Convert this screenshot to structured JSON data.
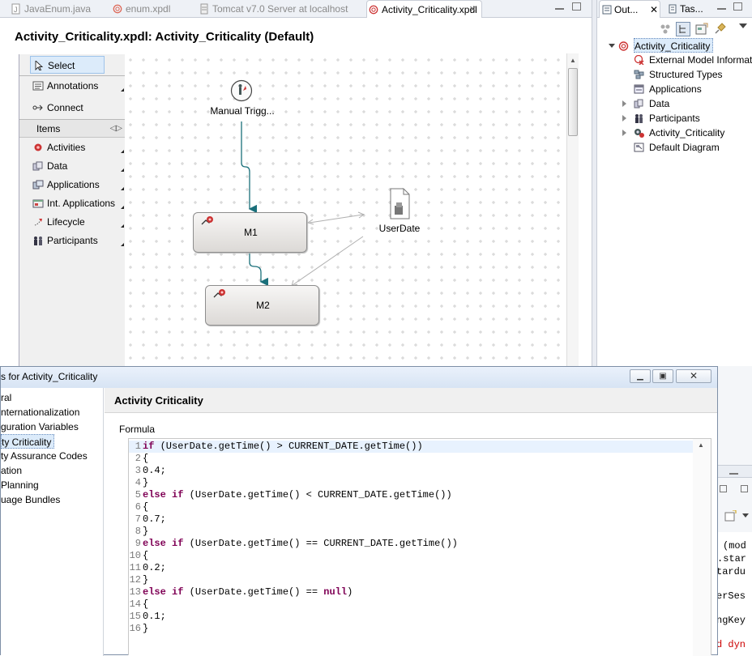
{
  "editor": {
    "tabs": [
      {
        "label": "JavaEnum.java"
      },
      {
        "label": "enum.xpdl"
      },
      {
        "label": "Tomcat v7.0 Server at localhost"
      },
      {
        "label": "Activity_Criticality.xpdl"
      }
    ],
    "title": "Activity_Criticality.xpdl: Activity_Criticality (Default)"
  },
  "palette": {
    "tools": [
      {
        "label": "Select",
        "icon": "cursor-icon"
      },
      {
        "label": "Annotations",
        "icon": "annotation-icon"
      },
      {
        "label": "Connect",
        "icon": "connect-icon"
      }
    ],
    "items_header": "Items",
    "items": [
      {
        "label": "Activities",
        "icon": "activity-icon"
      },
      {
        "label": "Data",
        "icon": "data-icon"
      },
      {
        "label": "Applications",
        "icon": "application-icon"
      },
      {
        "label": "Int. Applications",
        "icon": "interactive-application-icon"
      },
      {
        "label": "Lifecycle",
        "icon": "lifecycle-icon"
      },
      {
        "label": "Participants",
        "icon": "participants-icon"
      }
    ]
  },
  "diagram": {
    "trigger": {
      "label": "Manual Trigg..."
    },
    "data_node": {
      "label": "UserDate"
    },
    "activities": [
      {
        "label": "M1"
      },
      {
        "label": "M2"
      }
    ]
  },
  "outline": {
    "tabs": [
      {
        "label": "Out..."
      },
      {
        "label": "Tas..."
      }
    ],
    "root": "Activity_Criticality",
    "items": [
      {
        "label": "External Model Informat",
        "icon": "external-model-icon"
      },
      {
        "label": "Structured Types",
        "icon": "structured-types-icon"
      },
      {
        "label": "Applications",
        "icon": "applications-icon"
      },
      {
        "label": "Data",
        "icon": "data-icon",
        "expandable": true
      },
      {
        "label": "Participants",
        "icon": "participants-icon",
        "expandable": true
      },
      {
        "label": "Activity_Criticality",
        "icon": "process-icon",
        "expandable": true
      },
      {
        "label": "Default Diagram",
        "icon": "diagram-icon"
      }
    ]
  },
  "dialog": {
    "title": "s for Activity_Criticality",
    "header": "Activity Criticality",
    "formula_label": "Formula",
    "nav": [
      "ral",
      "nternationalization",
      "guration Variables",
      "ty Criticality",
      "ty Assurance Codes",
      "ation",
      "Planning",
      "uage Bundles"
    ],
    "selected_nav_index": 3,
    "code": [
      {
        "n": "1",
        "tokens": [
          {
            "t": "if",
            "k": true
          },
          {
            "t": " (UserDate.getTime() > CURRENT_DATE.getTime())"
          }
        ]
      },
      {
        "n": "2",
        "tokens": [
          {
            "t": "{"
          }
        ]
      },
      {
        "n": "3",
        "tokens": [
          {
            "t": "0.4;"
          }
        ]
      },
      {
        "n": "4",
        "tokens": [
          {
            "t": "}"
          }
        ]
      },
      {
        "n": "5",
        "tokens": [
          {
            "t": "else",
            "k": true
          },
          {
            "t": " "
          },
          {
            "t": "if",
            "k": true
          },
          {
            "t": " (UserDate.getTime() < CURRENT_DATE.getTime())"
          }
        ]
      },
      {
        "n": "6",
        "tokens": [
          {
            "t": "{"
          }
        ]
      },
      {
        "n": "7",
        "tokens": [
          {
            "t": "0.7;"
          }
        ]
      },
      {
        "n": "8",
        "tokens": [
          {
            "t": "}"
          }
        ]
      },
      {
        "n": "9",
        "tokens": [
          {
            "t": "else",
            "k": true
          },
          {
            "t": " "
          },
          {
            "t": "if",
            "k": true
          },
          {
            "t": " (UserDate.getTime() == CURRENT_DATE.getTime())"
          }
        ]
      },
      {
        "n": "10",
        "tokens": [
          {
            "t": "{"
          }
        ]
      },
      {
        "n": "11",
        "tokens": [
          {
            "t": "0.2;"
          }
        ]
      },
      {
        "n": "12",
        "tokens": [
          {
            "t": "}"
          }
        ]
      },
      {
        "n": "13",
        "tokens": [
          {
            "t": "else",
            "k": true
          },
          {
            "t": " "
          },
          {
            "t": "if",
            "k": true
          },
          {
            "t": " (UserDate.getTime() == "
          },
          {
            "t": "null",
            "k": true
          },
          {
            "t": ")"
          }
        ]
      },
      {
        "n": "14",
        "tokens": [
          {
            "t": "{"
          }
        ]
      },
      {
        "n": "15",
        "tokens": [
          {
            "t": "0.1;"
          }
        ]
      },
      {
        "n": "16",
        "tokens": [
          {
            "t": "}"
          }
        ]
      }
    ]
  },
  "background_fragments": [
    {
      "text": "(mod"
    },
    {
      "text": ".star"
    },
    {
      "text": "tardu"
    },
    {
      "text": "erSes"
    },
    {
      "text": "ngKey"
    },
    {
      "text": "d dyn"
    }
  ],
  "colors": {
    "keyword": "#7f0055",
    "flow": "#1a6f7a",
    "tab_bg": "#eef1f6",
    "current_line": "#e8f2fe"
  }
}
